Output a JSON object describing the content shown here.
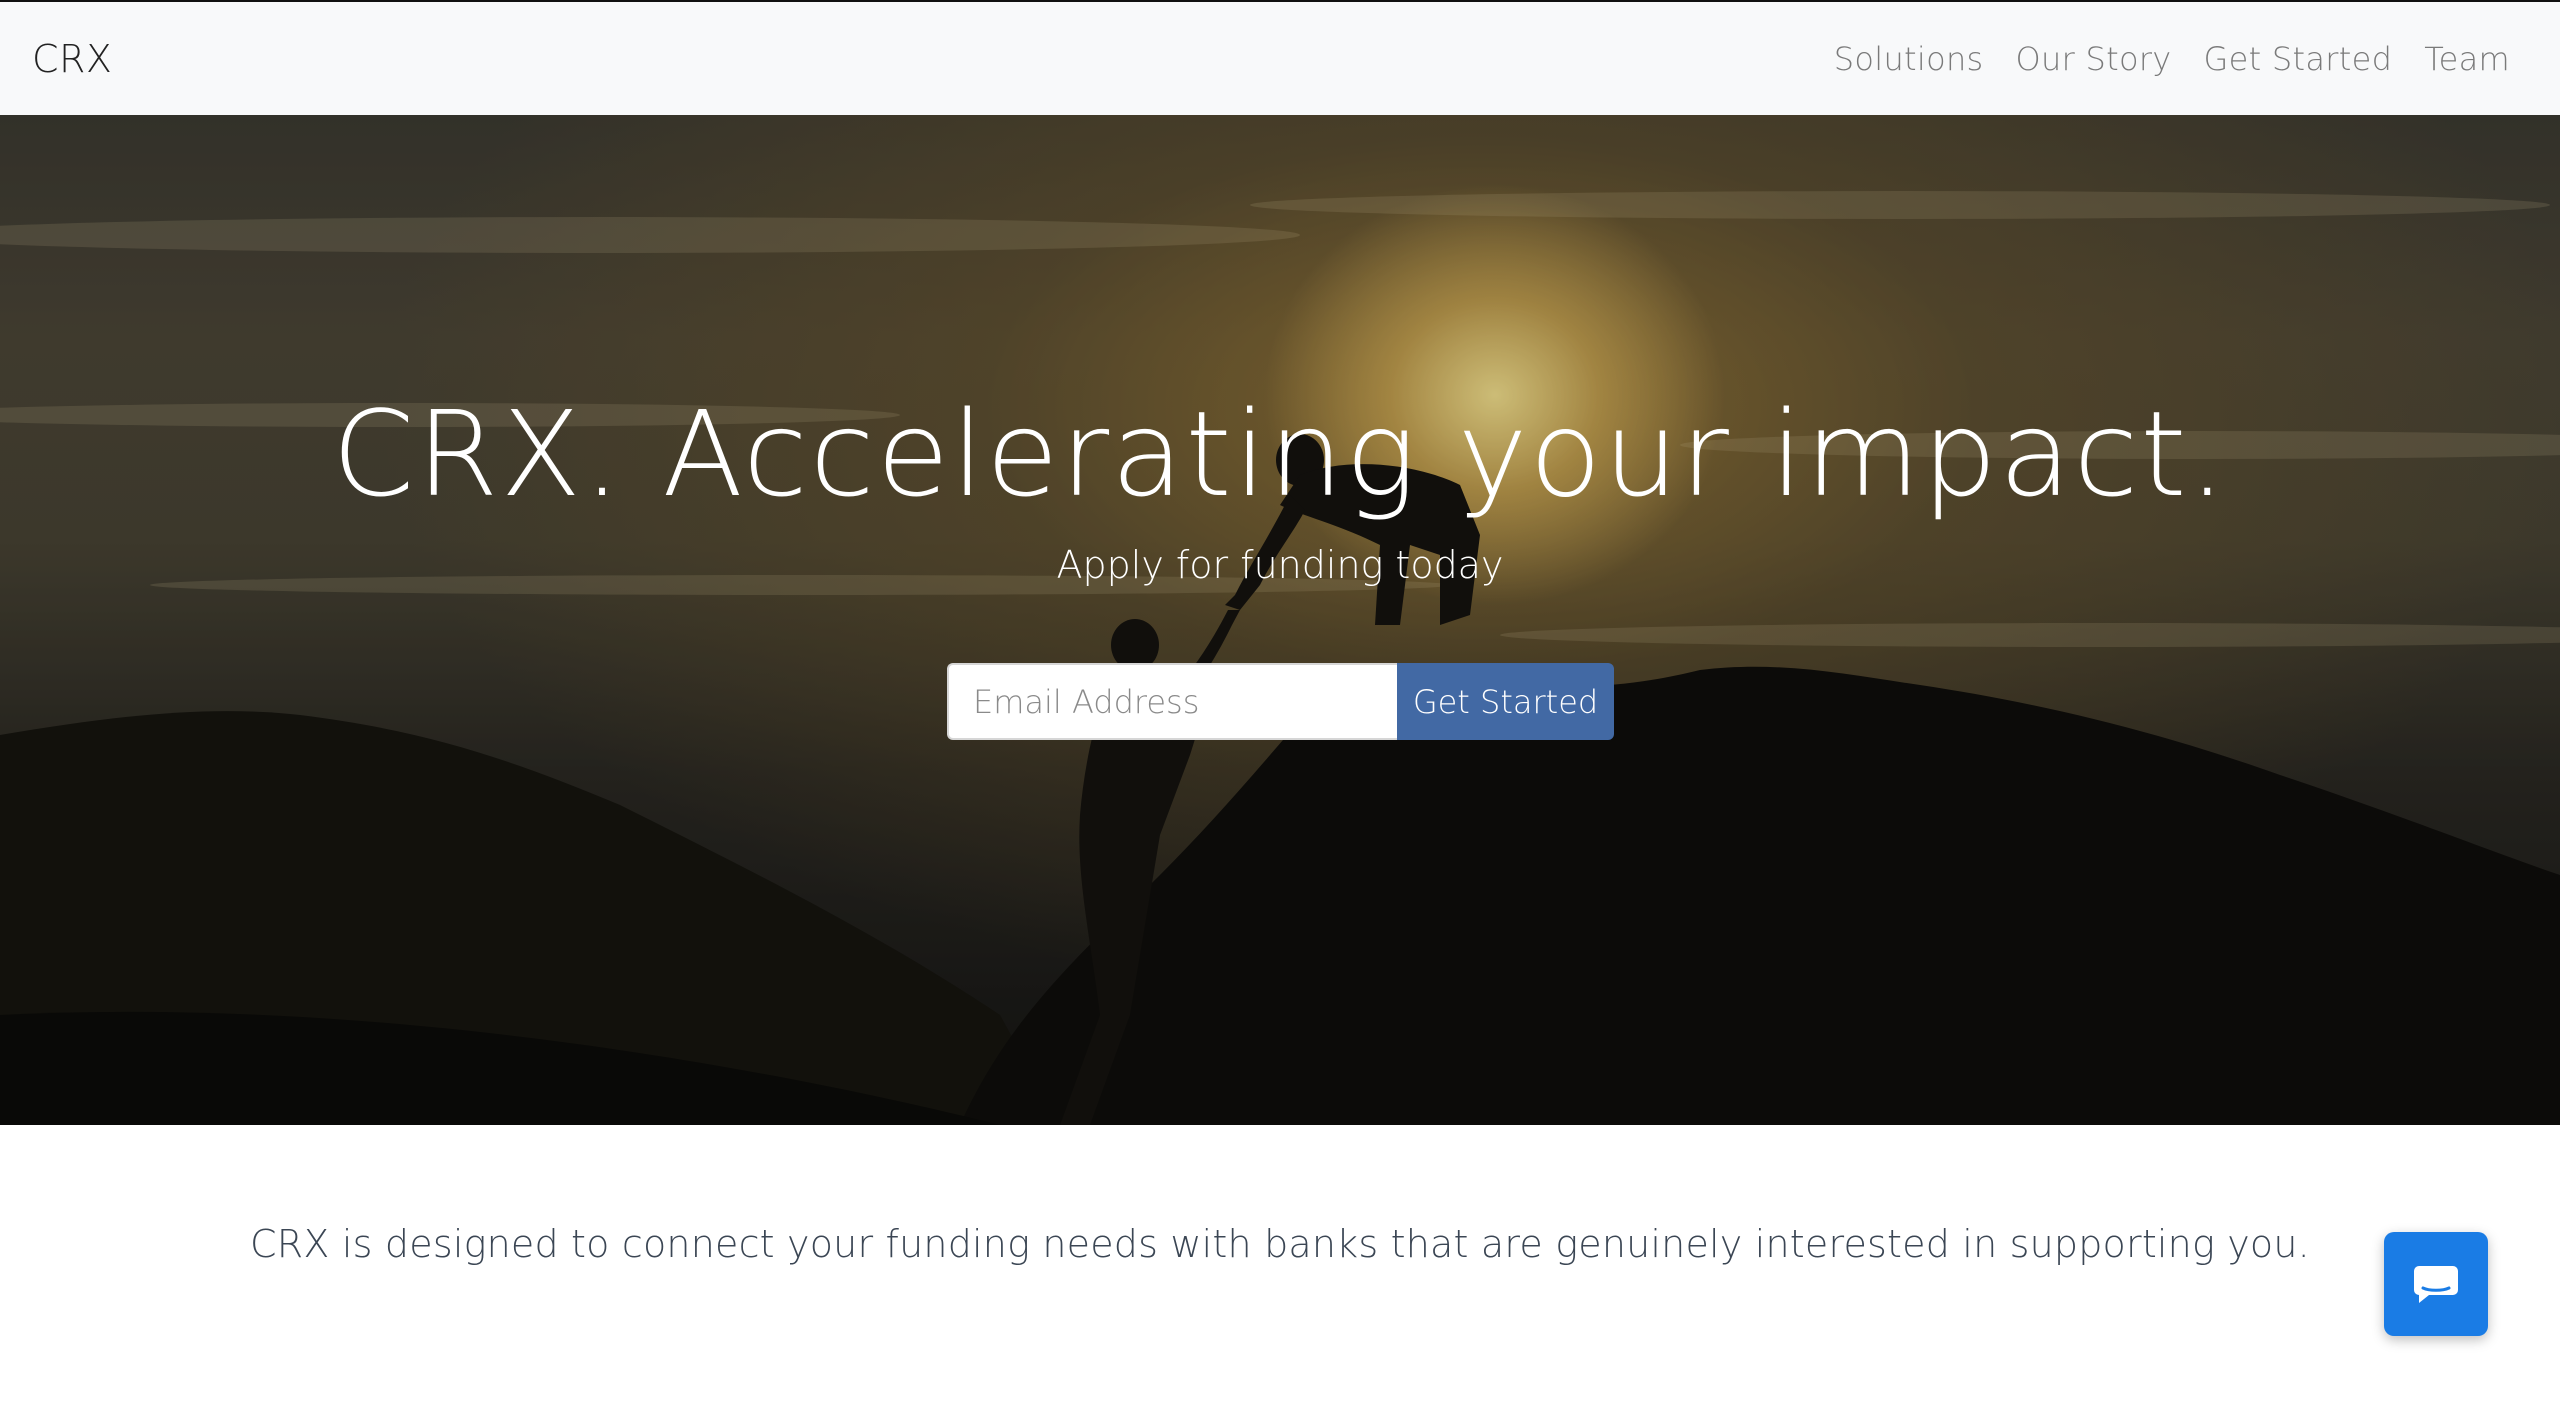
{
  "navbar": {
    "brand": "CRX",
    "links": [
      {
        "label": "Solutions"
      },
      {
        "label": "Our Story"
      },
      {
        "label": "Get Started"
      },
      {
        "label": "Team"
      }
    ]
  },
  "hero": {
    "title": "CRX. Accelerating your impact.",
    "subtitle": "Apply for funding today",
    "email_placeholder": "Email Address",
    "email_value": "",
    "cta_label": "Get Started",
    "background_image": "silhouette of two climbers helping each other up a rock at sunset"
  },
  "intro": {
    "text": "CRX is designed to connect your funding needs with banks that are genuinely interested in supporting you."
  },
  "chat_widget": {
    "icon": "chat-bubble-icon"
  },
  "colors": {
    "navbar_bg": "#f8f9fa",
    "cta_bg": "#4269a4",
    "chat_bg": "#1a7ce5",
    "intro_text": "#3b4654"
  }
}
